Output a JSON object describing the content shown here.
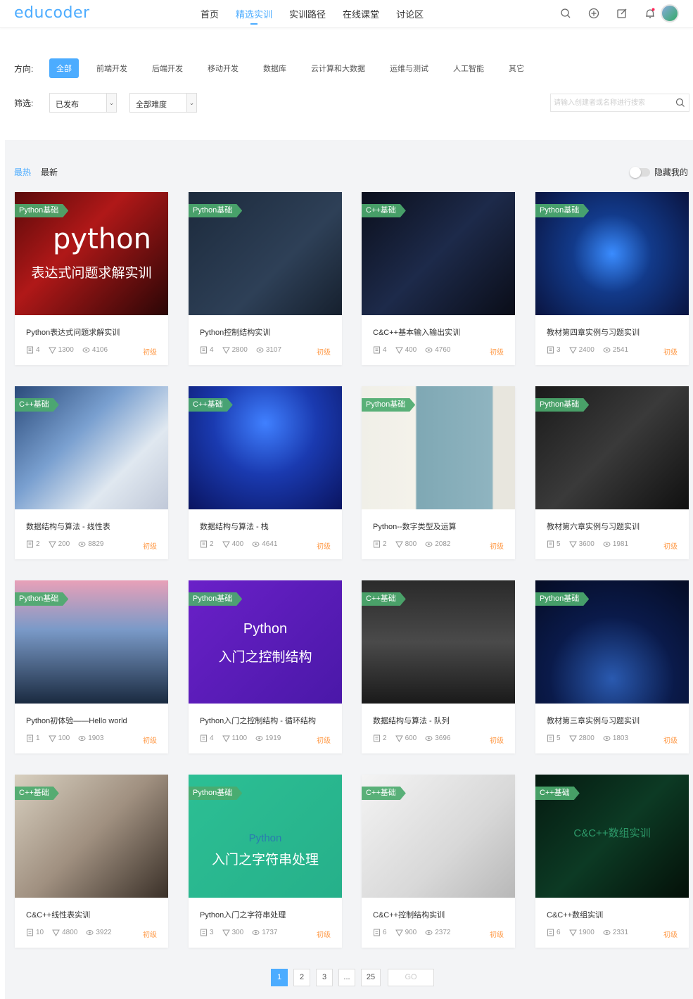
{
  "header": {
    "logo": "educoder",
    "nav": [
      "首页",
      "精选实训",
      "实训路径",
      "在线课堂",
      "讨论区"
    ],
    "active_nav": 1,
    "icons": [
      "search-icon",
      "plus-circle-icon",
      "edit-icon",
      "bell-icon"
    ]
  },
  "filters": {
    "direction_label": "方向:",
    "directions": [
      "全部",
      "前端开发",
      "后端开发",
      "移动开发",
      "数据库",
      "云计算和大数据",
      "运维与测试",
      "人工智能",
      "其它"
    ],
    "active_direction": 0,
    "filter_label": "筛选:",
    "status_select": "已发布",
    "difficulty_select": "全部难度",
    "search_placeholder": "请输入创建者或名称进行搜索"
  },
  "sort": {
    "tabs": [
      "最热",
      "最新"
    ],
    "active": 0,
    "hide_mine": "隐藏我的"
  },
  "cards": [
    {
      "tag": "Python基础",
      "title": "Python表达式问题求解实训",
      "challenges": "4",
      "likes": "1300",
      "views": "4106",
      "level": "初级",
      "thumb_line1": "python",
      "thumb_line2": "表达式问题求解实训"
    },
    {
      "tag": "Python基础",
      "title": "Python控制结构实训",
      "challenges": "4",
      "likes": "2800",
      "views": "3107",
      "level": "初级",
      "thumb_line1": "",
      "thumb_line2": ""
    },
    {
      "tag": "C++基础",
      "title": "C&C++基本输入输出实训",
      "challenges": "4",
      "likes": "400",
      "views": "4760",
      "level": "初级",
      "thumb_line1": "",
      "thumb_line2": ""
    },
    {
      "tag": "Python基础",
      "title": "教材第四章实例与习题实训",
      "challenges": "3",
      "likes": "2400",
      "views": "2541",
      "level": "初级",
      "thumb_line1": "",
      "thumb_line2": ""
    },
    {
      "tag": "C++基础",
      "title": "数据结构与算法 - 线性表",
      "challenges": "2",
      "likes": "200",
      "views": "8829",
      "level": "初级",
      "thumb_line1": "",
      "thumb_line2": ""
    },
    {
      "tag": "C++基础",
      "title": "数据结构与算法 - 栈",
      "challenges": "2",
      "likes": "400",
      "views": "4641",
      "level": "初级",
      "thumb_line1": "",
      "thumb_line2": ""
    },
    {
      "tag": "Python基础",
      "title": "Python--数字类型及运算",
      "challenges": "2",
      "likes": "800",
      "views": "2082",
      "level": "初级",
      "thumb_line1": "",
      "thumb_line2": ""
    },
    {
      "tag": "Python基础",
      "title": "教材第六章实例与习题实训",
      "challenges": "5",
      "likes": "3600",
      "views": "1981",
      "level": "初级",
      "thumb_line1": "",
      "thumb_line2": ""
    },
    {
      "tag": "Python基础",
      "title": "Python初体验——Hello world",
      "challenges": "1",
      "likes": "100",
      "views": "1903",
      "level": "初级",
      "thumb_line1": "",
      "thumb_line2": ""
    },
    {
      "tag": "Python基础",
      "title": "Python入门之控制结构 - 循环结构",
      "challenges": "4",
      "likes": "1100",
      "views": "1919",
      "level": "初级",
      "thumb_line1": "Python",
      "thumb_line2": "入门之控制结构"
    },
    {
      "tag": "C++基础",
      "title": "数据结构与算法 - 队列",
      "challenges": "2",
      "likes": "600",
      "views": "3696",
      "level": "初级",
      "thumb_line1": "",
      "thumb_line2": ""
    },
    {
      "tag": "Python基础",
      "title": "教材第三章实例与习题实训",
      "challenges": "5",
      "likes": "2800",
      "views": "1803",
      "level": "初级",
      "thumb_line1": "",
      "thumb_line2": ""
    },
    {
      "tag": "C++基础",
      "title": "C&C++线性表实训",
      "challenges": "10",
      "likes": "4800",
      "views": "3922",
      "level": "初级",
      "thumb_line1": "",
      "thumb_line2": ""
    },
    {
      "tag": "Python基础",
      "title": "Python入门之字符串处理",
      "challenges": "3",
      "likes": "300",
      "views": "1737",
      "level": "初级",
      "thumb_line1": "Python",
      "thumb_line2": "入门之字符串处理"
    },
    {
      "tag": "C++基础",
      "title": "C&C++控制结构实训",
      "challenges": "6",
      "likes": "900",
      "views": "2372",
      "level": "初级",
      "thumb_line1": "",
      "thumb_line2": ""
    },
    {
      "tag": "C++基础",
      "title": "C&C++数组实训",
      "challenges": "6",
      "likes": "1900",
      "views": "2331",
      "level": "初级",
      "thumb_line1": "C&C++数组实训",
      "thumb_line2": ""
    }
  ],
  "pagination": {
    "pages": [
      "1",
      "2",
      "3",
      "...",
      "25"
    ],
    "active": 0,
    "go_label": "GO"
  },
  "colors": {
    "accent": "#4cacff",
    "tag_green": "#4caa6e",
    "level_orange": "#ff9d4d"
  }
}
